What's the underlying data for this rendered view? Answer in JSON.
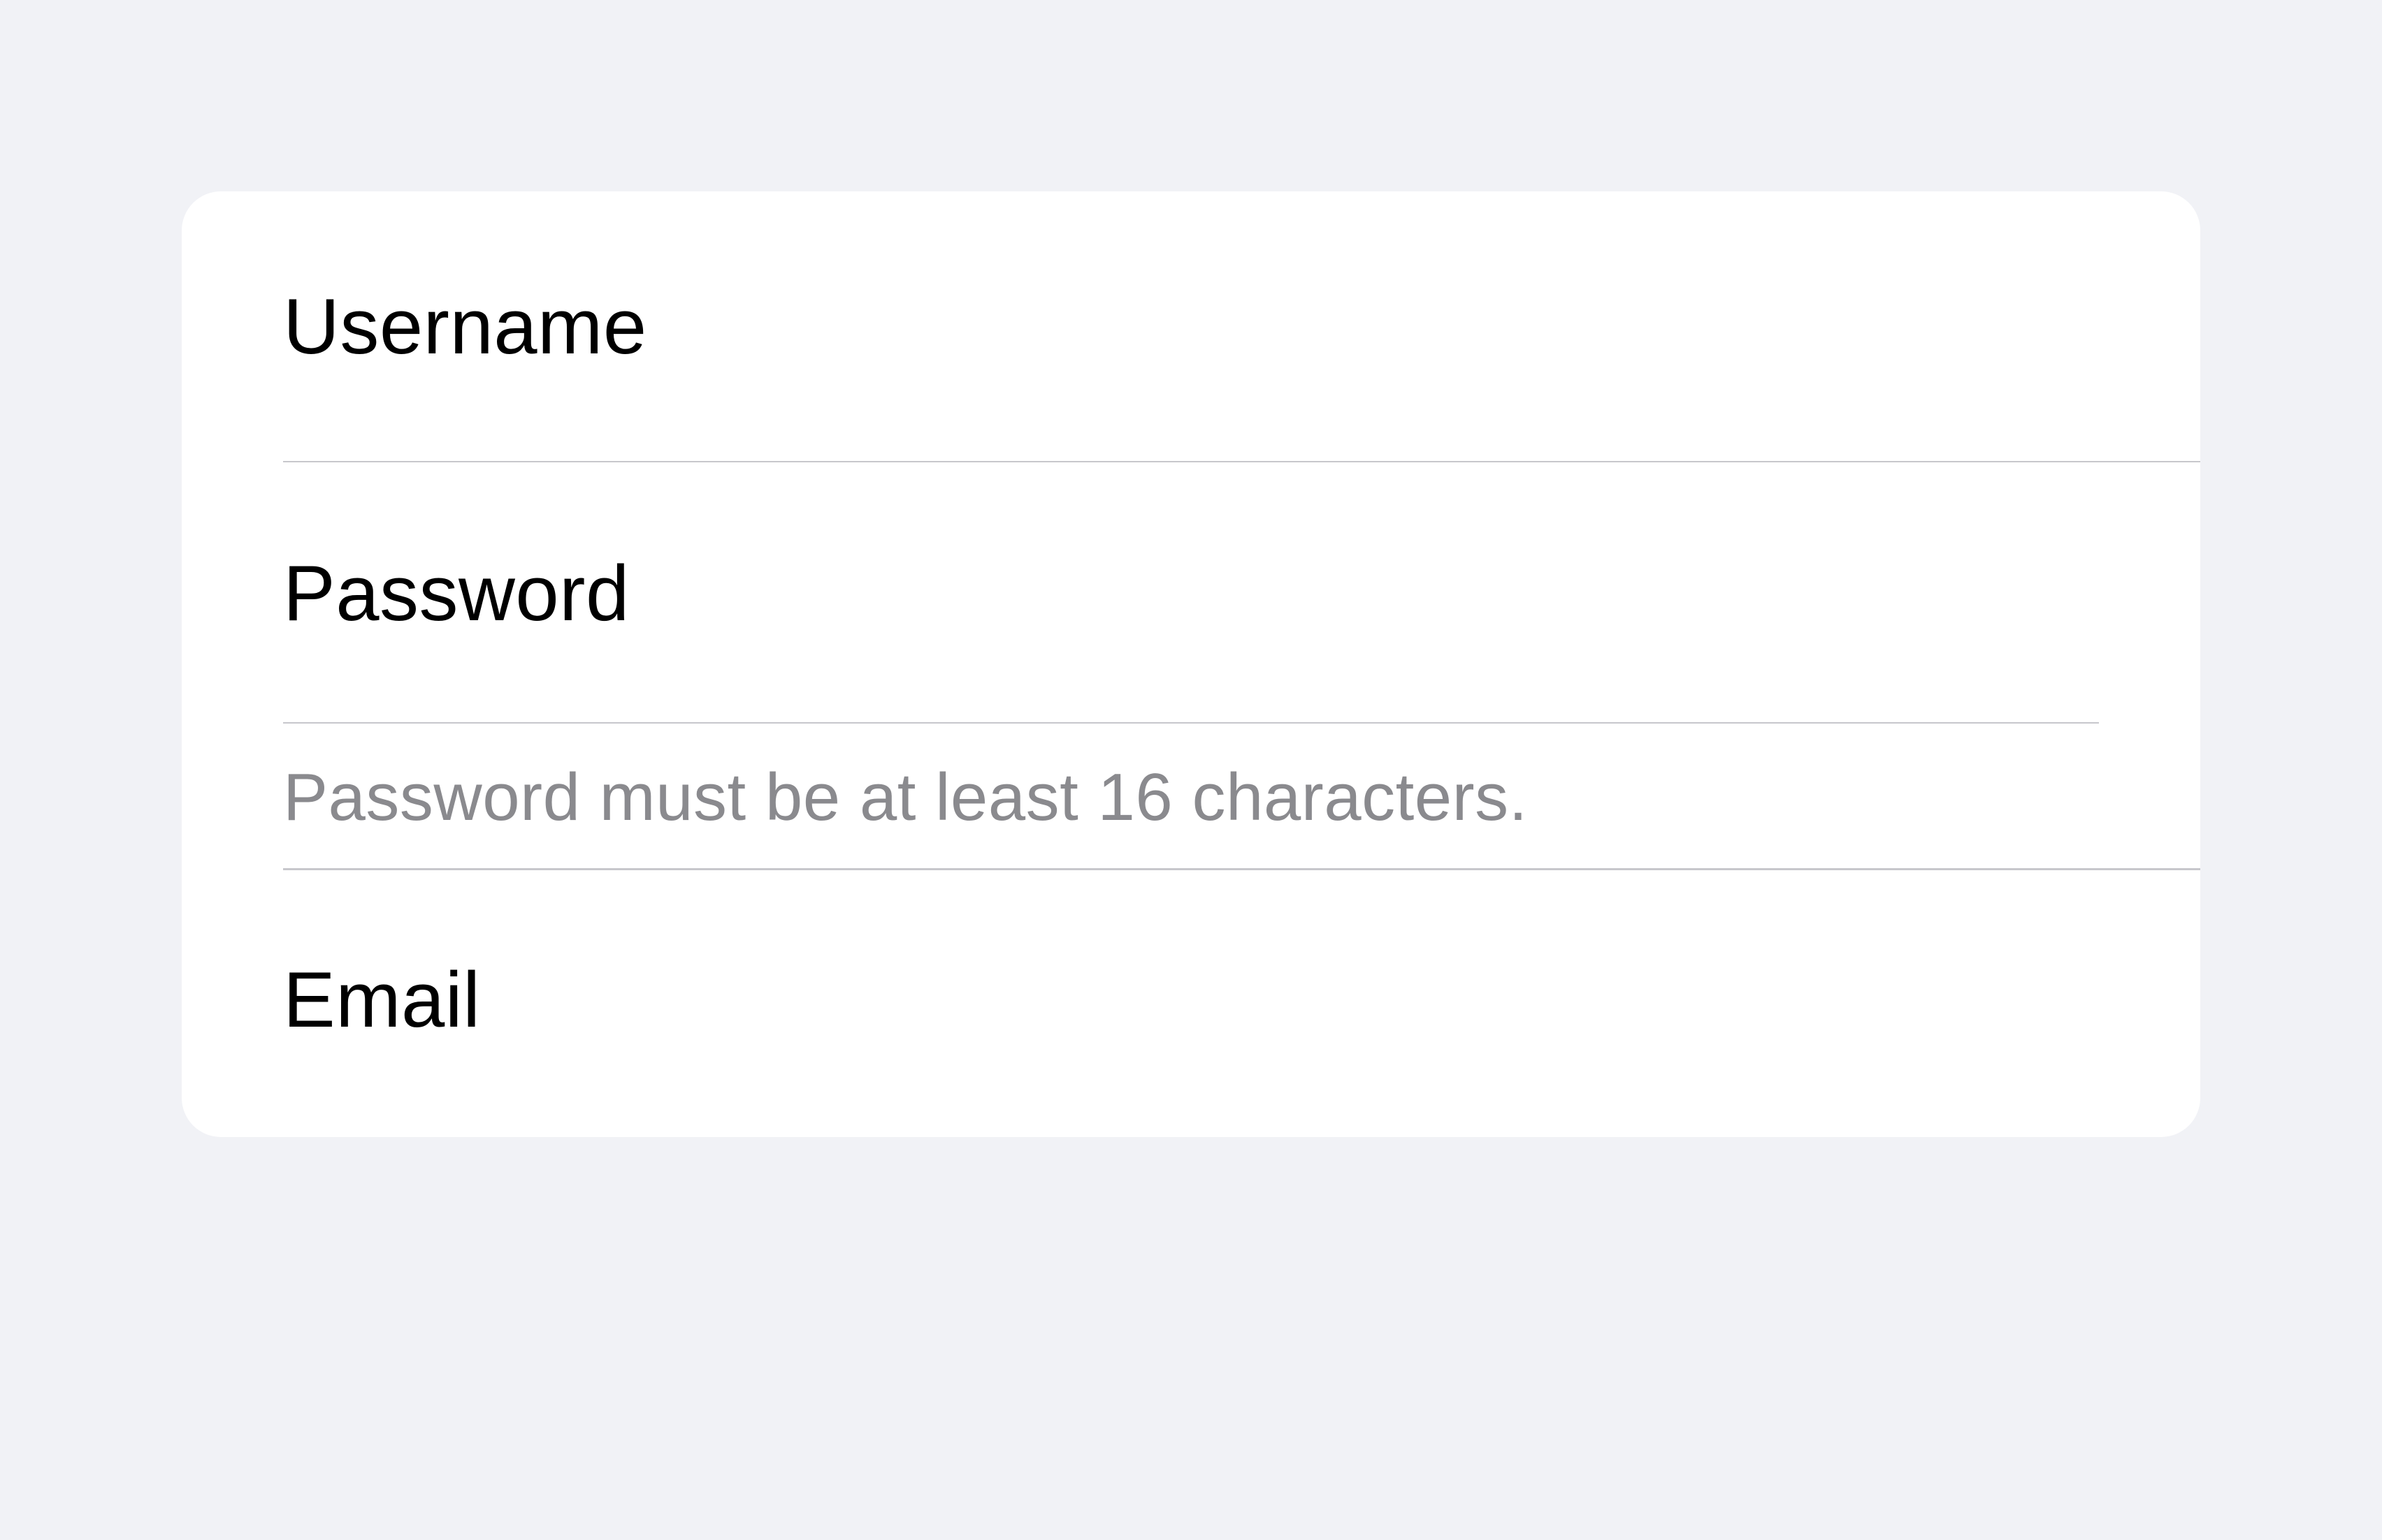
{
  "form": {
    "username": {
      "label": "Username"
    },
    "password": {
      "label": "Password",
      "helper": "Password must be at least 16 characters."
    },
    "email": {
      "label": "Email"
    }
  }
}
